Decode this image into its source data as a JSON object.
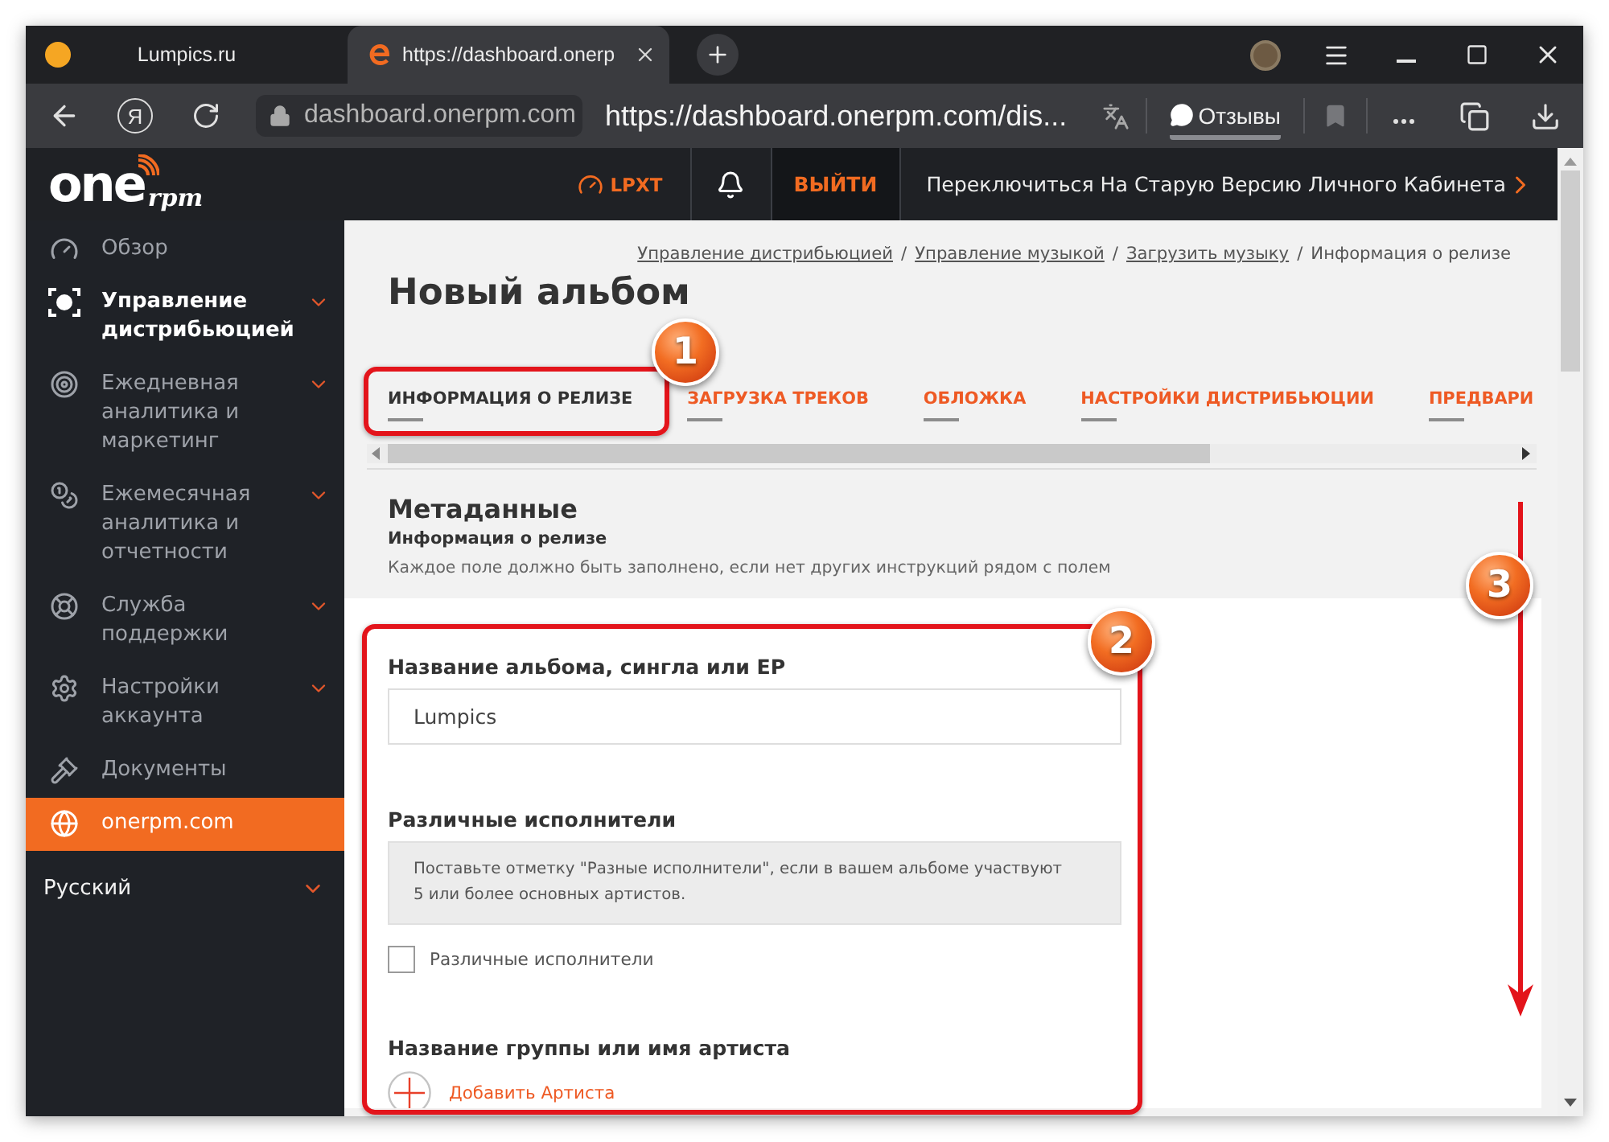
{
  "browser": {
    "tabs": [
      {
        "title": "Lumpics.ru",
        "selected": false
      },
      {
        "title": "https://dashboard.onerp",
        "selected": true
      }
    ],
    "home_button": "Я",
    "address_bar": {
      "domain": "dashboard.onerpm.com",
      "url": "https://dashboard.onerpm.com/dis..."
    },
    "feedback_button": "Отзывы"
  },
  "header": {
    "logo": {
      "wordmark": "one",
      "suffix": "rpm"
    },
    "badge": "LPXT",
    "logout": "ВЫЙТИ",
    "switch_link": "Переключиться На Старую Версию Личного Кабинета"
  },
  "sidebar": {
    "items": [
      {
        "label": "Обзор",
        "kind": "menu",
        "selected": false,
        "expandable": false
      },
      {
        "label": "Управление дистрибьюцией",
        "kind": "menu",
        "selected": true,
        "expandable": true
      },
      {
        "label": "Ежедневная аналитика и маркетинг",
        "kind": "menu",
        "selected": false,
        "expandable": true
      },
      {
        "label": "Ежемесячная аналитика и отчетности",
        "kind": "menu",
        "selected": false,
        "expandable": true
      },
      {
        "label": "Служба поддержки",
        "kind": "menu",
        "selected": false,
        "expandable": true
      },
      {
        "label": "Настройки аккаунта",
        "kind": "menu",
        "selected": false,
        "expandable": true
      },
      {
        "label": "Документы",
        "kind": "menu",
        "selected": false,
        "expandable": false
      },
      {
        "label": "onerpm.com",
        "kind": "promo",
        "selected": false,
        "expandable": false
      }
    ],
    "language": "Русский"
  },
  "breadcrumbs": [
    {
      "label": "Управление дистрибьюцией",
      "kind": "link"
    },
    {
      "label": "/",
      "kind": "separator"
    },
    {
      "label": "Управление музыкой",
      "kind": "link"
    },
    {
      "label": "/",
      "kind": "separator"
    },
    {
      "label": "Загрузить музыку",
      "kind": "link"
    },
    {
      "label": "/",
      "kind": "separator"
    },
    {
      "label": "Информация о релизе",
      "kind": "current"
    }
  ],
  "page_title": "Новый альбом",
  "steps": [
    {
      "label": "ИНФОРМАЦИЯ О РЕЛИЗЕ",
      "selected": true
    },
    {
      "label": "ЗАГРУЗКА ТРЕКОВ",
      "selected": false
    },
    {
      "label": "ОБЛОЖКА",
      "selected": false
    },
    {
      "label": "НАСТРОЙКИ ДИСТРИБЬЮЦИИ",
      "selected": false
    },
    {
      "label": "ПРЕДВАРИ",
      "selected": false
    }
  ],
  "section": {
    "title": "Метаданные",
    "subtitle": "Информация о релизе",
    "hint": "Каждое поле должно быть заполнено, если нет других инструкций рядом с полем"
  },
  "form": {
    "fields": [
      {
        "kind": "text",
        "label": "Название альбома, сингла или EP",
        "value": "Lumpics"
      },
      {
        "kind": "checkbox",
        "label": "Различные исполнители",
        "note": "Поставьте отметку \"Разные исполнители\", если в вашем альбоме участвуют 5 или более основных артистов.",
        "checkbox_label": "Различные исполнители",
        "checked": false
      },
      {
        "kind": "artists",
        "label": "Название группы или имя артиста",
        "add_link": "Добавить Артиста"
      }
    ]
  },
  "annotations": [
    {
      "number": "1",
      "kind": "frame"
    },
    {
      "number": "2",
      "kind": "frame"
    },
    {
      "number": "3",
      "kind": "arrow"
    }
  ]
}
